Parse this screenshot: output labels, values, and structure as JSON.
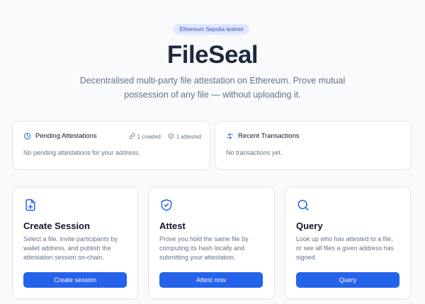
{
  "network_badge": "Ethereum Sepolia testnet",
  "title": "FileSeal",
  "subtitle": "Decentralised multi-party file attestation on Ethereum. Prove mutual possession of any file — without uploading it.",
  "pending": {
    "heading": "Pending Attestations",
    "created": "1 created",
    "attested": "1 attested",
    "empty": "No pending attestations for your address."
  },
  "recent": {
    "heading": "Recent Transactions",
    "empty": "No transactions yet."
  },
  "actions": {
    "create": {
      "title": "Create Session",
      "description": "Select a file, invite participants by wallet address, and publish the attestation session on-chain.",
      "button": "Create session",
      "icon": "file-plus-icon"
    },
    "attest": {
      "title": "Attest",
      "description": "Prove you hold the same file by computing its hash locally and submitting your attestation.",
      "button": "Attest now",
      "icon": "shield-check-icon"
    },
    "query": {
      "title": "Query",
      "description": "Look up who has attested to a file, or see all files a given address has signed.",
      "button": "Query",
      "icon": "search-icon"
    }
  },
  "colors": {
    "accent": "#2563eb",
    "badge_bg": "#e0e7ff",
    "muted_text": "#64748b"
  }
}
